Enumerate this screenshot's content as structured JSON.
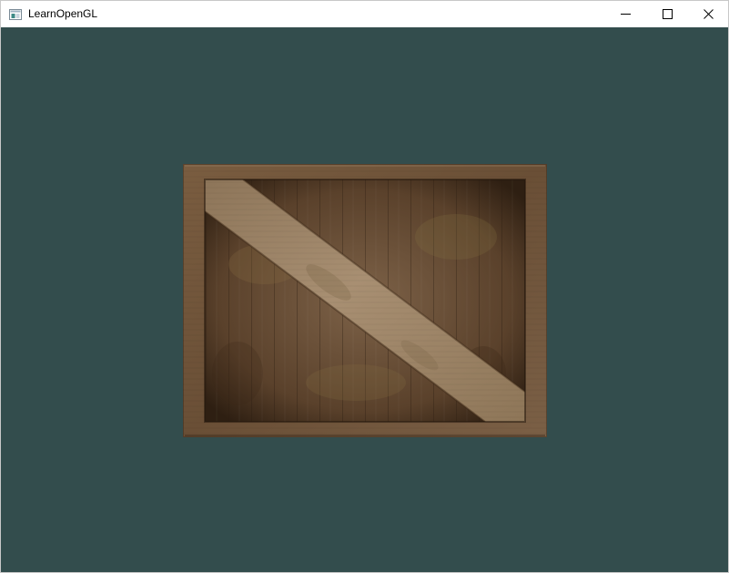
{
  "window": {
    "title": "LearnOpenGL",
    "app_icon": "window-app-icon",
    "caption_buttons": [
      {
        "name": "minimize",
        "icon": "minimize-icon"
      },
      {
        "name": "maximize",
        "icon": "maximize-icon"
      },
      {
        "name": "close",
        "icon": "close-icon"
      }
    ]
  },
  "viewport": {
    "clear_color": "#334d4d",
    "object": "textured-quad",
    "texture": "wooden-container",
    "texture_colors": {
      "frame": "#6e5238",
      "panel": "#5f4630",
      "diagonal_plank": "#9a8468",
      "shadow": "#2e1f12"
    }
  }
}
